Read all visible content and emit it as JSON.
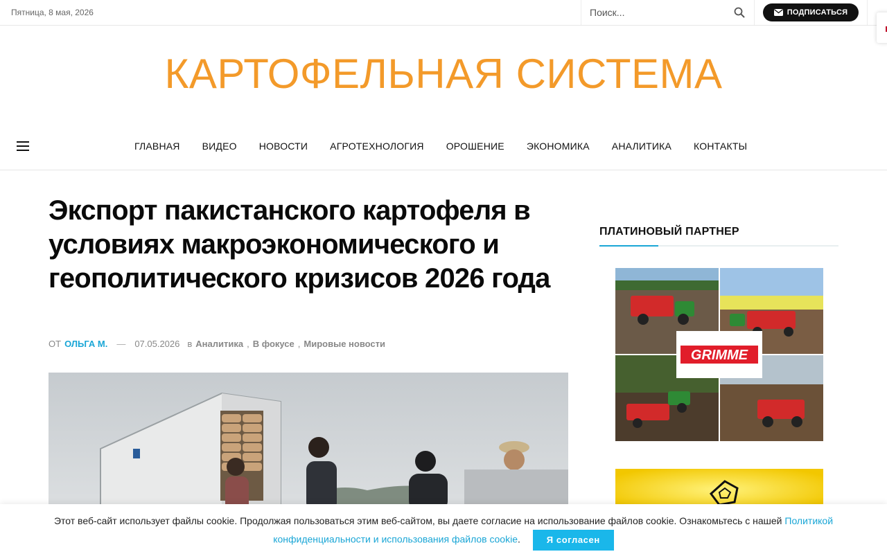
{
  "topbar": {
    "date": "Пятница, 8 мая, 2026",
    "search_placeholder": "Поиск...",
    "subscribe_label": "ПОДПИСАТЬСЯ"
  },
  "site": {
    "title": "КАРТОФЕЛЬНАЯ СИСТЕМА"
  },
  "nav": {
    "items": [
      "ГЛАВНАЯ",
      "ВИДЕО",
      "НОВОСТИ",
      "АГРОТЕХНОЛОГИЯ",
      "ОРОШЕНИЕ",
      "ЭКОНОМИКА",
      "АНАЛИТИКА",
      "КОНТАКТЫ"
    ]
  },
  "article": {
    "title": "Экспорт пакистанского картофеля в условиях макроэкономического и геополитического кризисов 2026 года",
    "by": "ОТ",
    "author": "ОЛЬГА М.",
    "dash": "—",
    "date": "07.05.2026",
    "in": "в",
    "categories": [
      "Аналитика",
      "В фокусе",
      "Мировые новости"
    ],
    "image_icon": "truck-loading-photo"
  },
  "sidebar": {
    "partner_title": "ПЛАТИНОВЫЙ ПАРТНЕР",
    "ad_brand": "GRIMME"
  },
  "cookie": {
    "text": "Этот веб-сайт использует файлы cookie. Продолжая пользоваться этим веб-сайтом, вы даете согласие на использование файлов cookie. Ознакомьтесь с нашей",
    "link": "Политикой конфиденциальности и использования файлов cookie",
    "period": ".",
    "agree_label": "Я согласен"
  },
  "colors": {
    "accent": "#1aa6d6",
    "logo": "#f39a2a",
    "button_dark": "#111111",
    "brand_red": "#e11d2a"
  }
}
